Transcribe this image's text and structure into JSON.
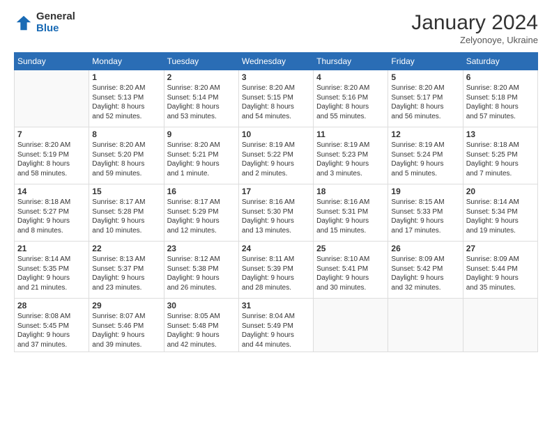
{
  "logo": {
    "general": "General",
    "blue": "Blue"
  },
  "header": {
    "month": "January 2024",
    "location": "Zelyonoye, Ukraine"
  },
  "days_of_week": [
    "Sunday",
    "Monday",
    "Tuesday",
    "Wednesday",
    "Thursday",
    "Friday",
    "Saturday"
  ],
  "weeks": [
    [
      {
        "day": "",
        "detail": ""
      },
      {
        "day": "1",
        "detail": "Sunrise: 8:20 AM\nSunset: 5:13 PM\nDaylight: 8 hours\nand 52 minutes."
      },
      {
        "day": "2",
        "detail": "Sunrise: 8:20 AM\nSunset: 5:14 PM\nDaylight: 8 hours\nand 53 minutes."
      },
      {
        "day": "3",
        "detail": "Sunrise: 8:20 AM\nSunset: 5:15 PM\nDaylight: 8 hours\nand 54 minutes."
      },
      {
        "day": "4",
        "detail": "Sunrise: 8:20 AM\nSunset: 5:16 PM\nDaylight: 8 hours\nand 55 minutes."
      },
      {
        "day": "5",
        "detail": "Sunrise: 8:20 AM\nSunset: 5:17 PM\nDaylight: 8 hours\nand 56 minutes."
      },
      {
        "day": "6",
        "detail": "Sunrise: 8:20 AM\nSunset: 5:18 PM\nDaylight: 8 hours\nand 57 minutes."
      }
    ],
    [
      {
        "day": "7",
        "detail": "Sunrise: 8:20 AM\nSunset: 5:19 PM\nDaylight: 8 hours\nand 58 minutes."
      },
      {
        "day": "8",
        "detail": "Sunrise: 8:20 AM\nSunset: 5:20 PM\nDaylight: 8 hours\nand 59 minutes."
      },
      {
        "day": "9",
        "detail": "Sunrise: 8:20 AM\nSunset: 5:21 PM\nDaylight: 9 hours\nand 1 minute."
      },
      {
        "day": "10",
        "detail": "Sunrise: 8:19 AM\nSunset: 5:22 PM\nDaylight: 9 hours\nand 2 minutes."
      },
      {
        "day": "11",
        "detail": "Sunrise: 8:19 AM\nSunset: 5:23 PM\nDaylight: 9 hours\nand 3 minutes."
      },
      {
        "day": "12",
        "detail": "Sunrise: 8:19 AM\nSunset: 5:24 PM\nDaylight: 9 hours\nand 5 minutes."
      },
      {
        "day": "13",
        "detail": "Sunrise: 8:18 AM\nSunset: 5:25 PM\nDaylight: 9 hours\nand 7 minutes."
      }
    ],
    [
      {
        "day": "14",
        "detail": "Sunrise: 8:18 AM\nSunset: 5:27 PM\nDaylight: 9 hours\nand 8 minutes."
      },
      {
        "day": "15",
        "detail": "Sunrise: 8:17 AM\nSunset: 5:28 PM\nDaylight: 9 hours\nand 10 minutes."
      },
      {
        "day": "16",
        "detail": "Sunrise: 8:17 AM\nSunset: 5:29 PM\nDaylight: 9 hours\nand 12 minutes."
      },
      {
        "day": "17",
        "detail": "Sunrise: 8:16 AM\nSunset: 5:30 PM\nDaylight: 9 hours\nand 13 minutes."
      },
      {
        "day": "18",
        "detail": "Sunrise: 8:16 AM\nSunset: 5:31 PM\nDaylight: 9 hours\nand 15 minutes."
      },
      {
        "day": "19",
        "detail": "Sunrise: 8:15 AM\nSunset: 5:33 PM\nDaylight: 9 hours\nand 17 minutes."
      },
      {
        "day": "20",
        "detail": "Sunrise: 8:14 AM\nSunset: 5:34 PM\nDaylight: 9 hours\nand 19 minutes."
      }
    ],
    [
      {
        "day": "21",
        "detail": "Sunrise: 8:14 AM\nSunset: 5:35 PM\nDaylight: 9 hours\nand 21 minutes."
      },
      {
        "day": "22",
        "detail": "Sunrise: 8:13 AM\nSunset: 5:37 PM\nDaylight: 9 hours\nand 23 minutes."
      },
      {
        "day": "23",
        "detail": "Sunrise: 8:12 AM\nSunset: 5:38 PM\nDaylight: 9 hours\nand 26 minutes."
      },
      {
        "day": "24",
        "detail": "Sunrise: 8:11 AM\nSunset: 5:39 PM\nDaylight: 9 hours\nand 28 minutes."
      },
      {
        "day": "25",
        "detail": "Sunrise: 8:10 AM\nSunset: 5:41 PM\nDaylight: 9 hours\nand 30 minutes."
      },
      {
        "day": "26",
        "detail": "Sunrise: 8:09 AM\nSunset: 5:42 PM\nDaylight: 9 hours\nand 32 minutes."
      },
      {
        "day": "27",
        "detail": "Sunrise: 8:09 AM\nSunset: 5:44 PM\nDaylight: 9 hours\nand 35 minutes."
      }
    ],
    [
      {
        "day": "28",
        "detail": "Sunrise: 8:08 AM\nSunset: 5:45 PM\nDaylight: 9 hours\nand 37 minutes."
      },
      {
        "day": "29",
        "detail": "Sunrise: 8:07 AM\nSunset: 5:46 PM\nDaylight: 9 hours\nand 39 minutes."
      },
      {
        "day": "30",
        "detail": "Sunrise: 8:05 AM\nSunset: 5:48 PM\nDaylight: 9 hours\nand 42 minutes."
      },
      {
        "day": "31",
        "detail": "Sunrise: 8:04 AM\nSunset: 5:49 PM\nDaylight: 9 hours\nand 44 minutes."
      },
      {
        "day": "",
        "detail": ""
      },
      {
        "day": "",
        "detail": ""
      },
      {
        "day": "",
        "detail": ""
      }
    ]
  ]
}
